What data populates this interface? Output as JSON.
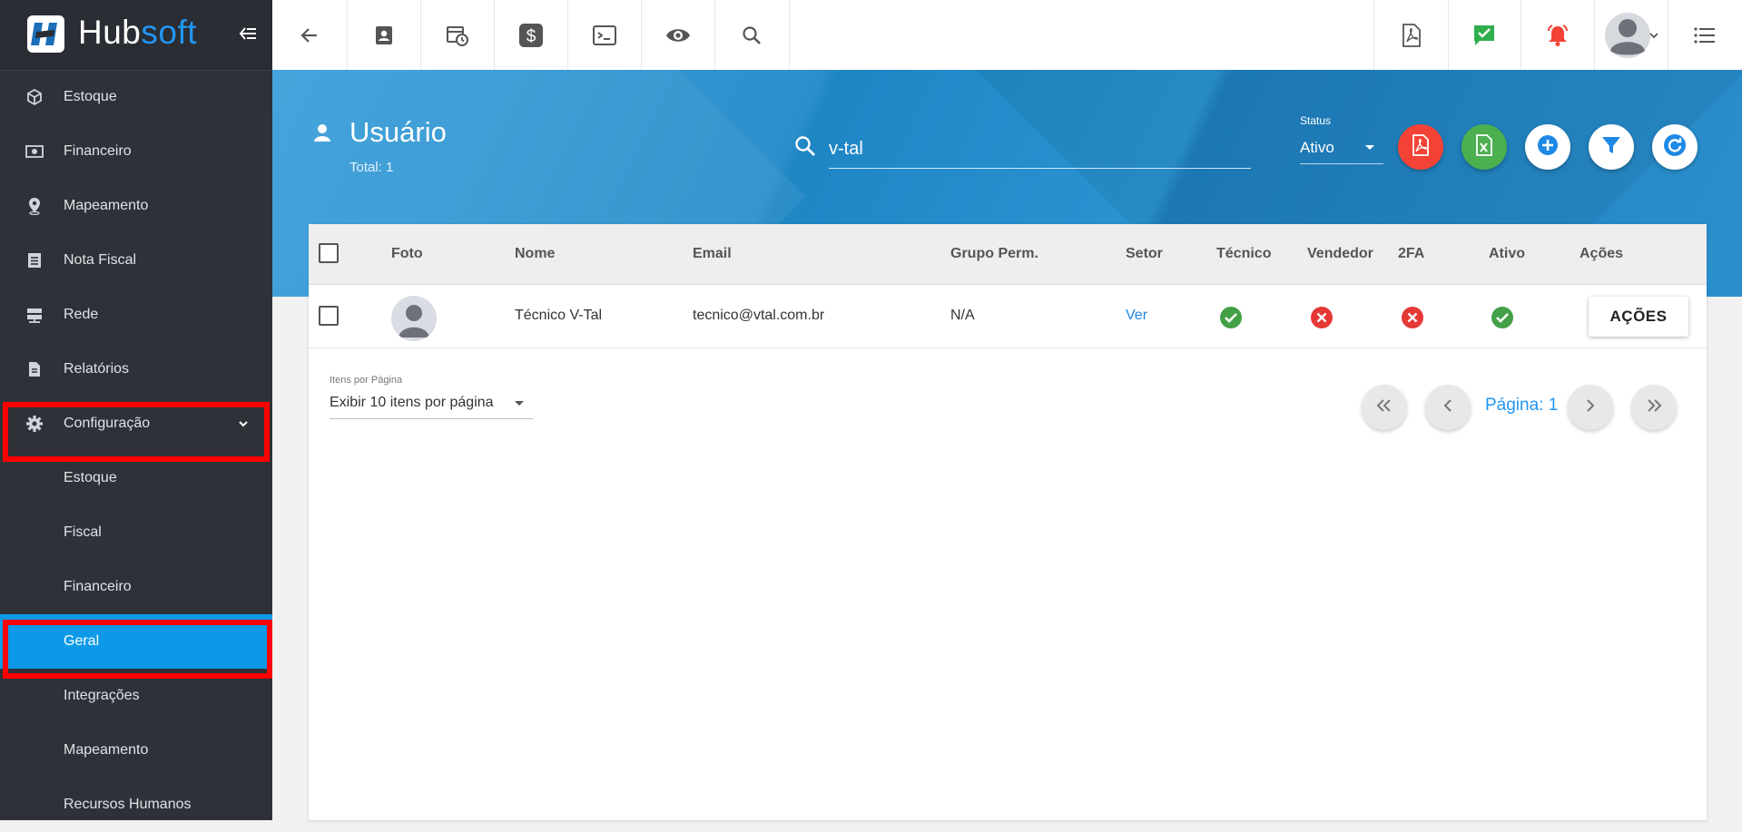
{
  "brand": {
    "name_part1": "Hub",
    "name_part2": "soft"
  },
  "sidebar": {
    "items": [
      {
        "label": "Estoque",
        "icon": "cube-icon"
      },
      {
        "label": "Financeiro",
        "icon": "money-icon"
      },
      {
        "label": "Mapeamento",
        "icon": "map-pin-icon"
      },
      {
        "label": "Nota Fiscal",
        "icon": "document-list-icon"
      },
      {
        "label": "Rede",
        "icon": "server-icon"
      },
      {
        "label": "Relatórios",
        "icon": "report-icon"
      },
      {
        "label": "Configuração",
        "icon": "gear-icon",
        "expanded": true
      }
    ],
    "subitems": [
      {
        "label": "Estoque"
      },
      {
        "label": "Fiscal"
      },
      {
        "label": "Financeiro"
      },
      {
        "label": "Geral",
        "active": true
      },
      {
        "label": "Integrações"
      },
      {
        "label": "Mapeamento"
      },
      {
        "label": "Recursos Humanos"
      }
    ]
  },
  "topbar": {
    "icons": [
      "back-arrow-icon",
      "contact-card-icon",
      "calendar-clock-icon",
      "dollar-icon",
      "terminal-icon",
      "eye-icon",
      "search-icon",
      "pdf-icon",
      "chat-check-icon",
      "alarm-bell-icon",
      "user-avatar-icon",
      "list-menu-icon"
    ]
  },
  "header": {
    "title": "Usuário",
    "total": "Total: 1",
    "search_value": "v-tal",
    "status_label": "Status",
    "status_value": "Ativo"
  },
  "table": {
    "columns": [
      "Foto",
      "Nome",
      "Email",
      "Grupo Perm.",
      "Setor",
      "Técnico",
      "Vendedor",
      "2FA",
      "Ativo",
      "Ações"
    ],
    "rows": [
      {
        "nome": "Técnico V-Tal",
        "email": "tecnico@vtal.com.br",
        "grupo": "N/A",
        "setor": "Ver",
        "tecnico": true,
        "vendedor": false,
        "twofa": false,
        "ativo": true,
        "acoes_label": "AÇÕES"
      }
    ]
  },
  "pagination": {
    "per_page_label": "Itens por Página",
    "per_page_value": "Exibir 10 itens por página",
    "page_text": "Página: 1"
  },
  "colors": {
    "sidebar_bg": "#2e3238",
    "active_item": "#0d99e8",
    "header_blue": "#2a8fcc",
    "pdf_red": "#f44336",
    "excel_green": "#4caf50",
    "ok_green": "#43a047",
    "error_red": "#e53935",
    "highlight": "#ff0000"
  }
}
